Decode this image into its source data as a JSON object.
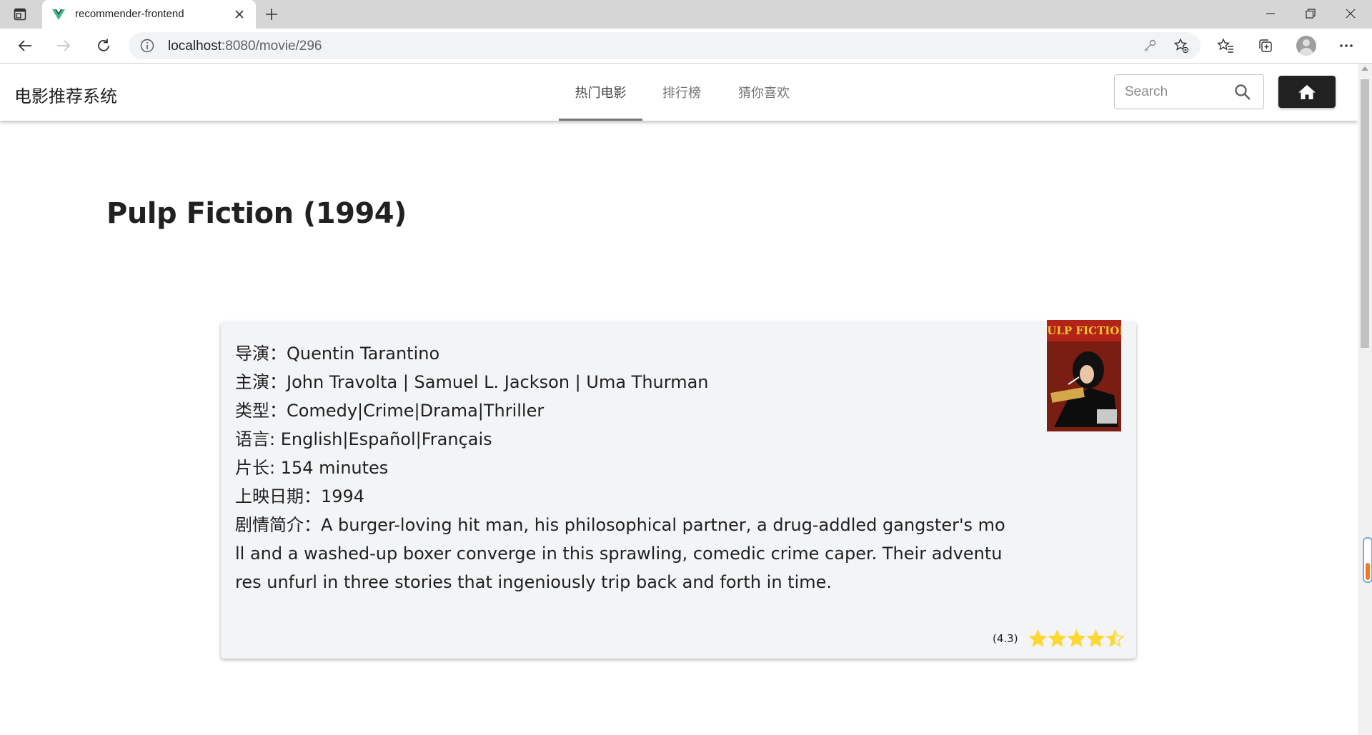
{
  "browser": {
    "tab_title": "recommender-frontend",
    "address_host": "localhost",
    "address_path": ":8080/movie/296"
  },
  "app": {
    "title": "电影推荐系统",
    "nav_tabs": [
      {
        "label": "热门电影",
        "active": true
      },
      {
        "label": "排行榜",
        "active": false
      },
      {
        "label": "猜你喜欢",
        "active": false
      }
    ],
    "search_placeholder": "Search"
  },
  "movie": {
    "title": "Pulp Fiction (1994)",
    "director_label": "导演：",
    "director": "Quentin Tarantino",
    "actors_label": "主演：",
    "actors": "John Travolta | Samuel L. Jackson | Uma Thurman",
    "genres_label": "类型：",
    "genres": "Comedy|Crime|Drama|Thriller",
    "language_label": "语言: ",
    "language": "English|Español|Français",
    "runtime_label": "片长: ",
    "runtime": "154 minutes",
    "release_label": "上映日期：",
    "release": "1994",
    "synopsis_label": "剧情简介：",
    "synopsis": "A burger-loving hit man, his philosophical partner, a drug-addled gangster's moll and a washed-up boxer converge in this sprawling, comedic crime caper. Their adventures unfurl in three stories that ingeniously trip back and forth in time.",
    "poster_text": "PULP FICTION",
    "rating_text": "(4.3)",
    "rating": 4.5,
    "rating_max": 5
  },
  "colors": {
    "star": "#fdd835",
    "card_bg": "#f2f4f6",
    "home_button": "#212121"
  }
}
